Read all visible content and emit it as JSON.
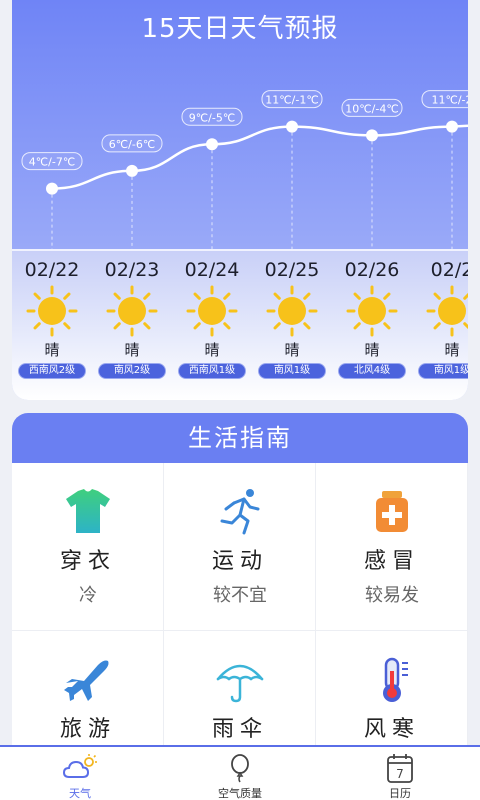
{
  "forecast": {
    "title": "15天日天气预报",
    "temps": [
      "4℃/-7℃",
      "6℃/-6℃",
      "9℃/-5℃",
      "11℃/-1℃",
      "10℃/-4℃",
      "11℃/-2"
    ],
    "days": [
      {
        "date": "02/22",
        "cond": "晴",
        "wind": "西南风2级"
      },
      {
        "date": "02/23",
        "cond": "晴",
        "wind": "南风2级"
      },
      {
        "date": "02/24",
        "cond": "晴",
        "wind": "西南风1级"
      },
      {
        "date": "02/25",
        "cond": "晴",
        "wind": "南风1级"
      },
      {
        "date": "02/26",
        "cond": "晴",
        "wind": "北风4级"
      },
      {
        "date": "02/2",
        "cond": "晴",
        "wind": "南风1级"
      }
    ],
    "high_temps": [
      4,
      6,
      9,
      11,
      10,
      11
    ],
    "weather_icon": "sun-icon"
  },
  "guide": {
    "title": "生活指南",
    "items": [
      {
        "name": "穿衣",
        "value": "冷",
        "icon": "tshirt-icon"
      },
      {
        "name": "运动",
        "value": "较不宜",
        "icon": "running-icon"
      },
      {
        "name": "感冒",
        "value": "较易发",
        "icon": "medicine-icon"
      },
      {
        "name": "旅游",
        "value": "",
        "icon": "airplane-icon"
      },
      {
        "name": "雨伞",
        "value": "",
        "icon": "umbrella-icon"
      },
      {
        "name": "风寒",
        "value": "",
        "icon": "thermometer-icon"
      }
    ]
  },
  "nav": {
    "items": [
      {
        "label": "天气",
        "icon": "weather-icon",
        "active": true
      },
      {
        "label": "空气质量",
        "icon": "balloon-icon",
        "active": false
      },
      {
        "label": "日历",
        "icon": "calendar-icon",
        "active": false
      }
    ],
    "calendar_day": "7"
  },
  "colors": {
    "accent": "#6a7ff2",
    "wind_badge": "#4c63dd",
    "sun": "#f7c21a"
  }
}
